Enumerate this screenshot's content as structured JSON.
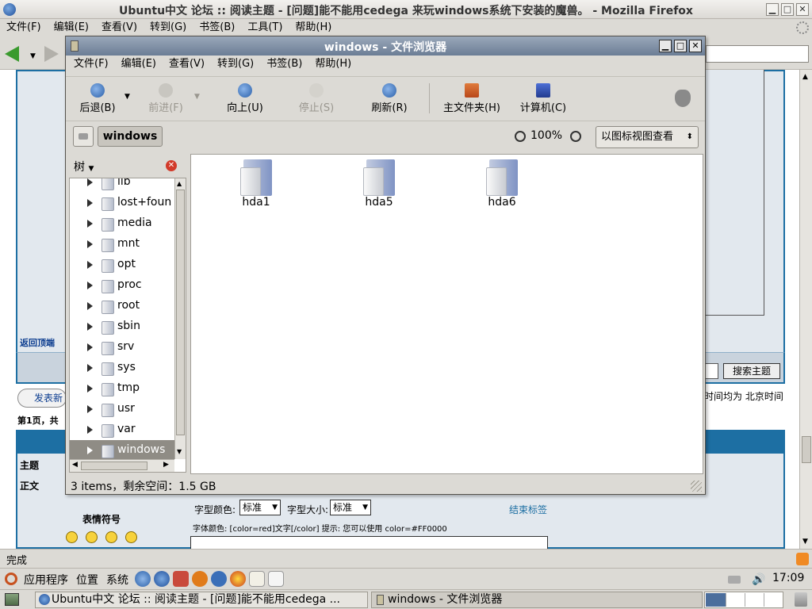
{
  "firefox": {
    "title": "Ubuntu中文 论坛 :: 阅读主题 - [问题]能不能用cedega 来玩windows系统下安装的魔兽。 - Mozilla Firefox",
    "menu": [
      "文件(F)",
      "编辑(E)",
      "查看(V)",
      "转到(G)",
      "书签(B)",
      "工具(T)",
      "帮助(H)"
    ],
    "status": "完成"
  },
  "forum": {
    "back_to_top": "返回顶端",
    "search_button": "搜索主题",
    "timezone_text": "时间均为 北京时间",
    "new_post": "发表新",
    "page_info": "第1页，共",
    "subject_label": "主题",
    "body_label": "正文",
    "font_color_label": "字型颜色:",
    "font_color_value": "标准",
    "font_size_label": "字型大小:",
    "font_size_value": "标准",
    "close_tags": "结束标签",
    "hint": "字体颜色: [color=red]文字[/color]  提示: 您可以使用 color=#FF0000",
    "emoticons_label": "表情符号"
  },
  "nautilus": {
    "title": "windows - 文件浏览器",
    "menu": [
      "文件(F)",
      "编辑(E)",
      "查看(V)",
      "转到(G)",
      "书签(B)",
      "帮助(H)"
    ],
    "toolbar": {
      "back": "后退(B)",
      "forward": "前进(F)",
      "up": "向上(U)",
      "stop": "停止(S)",
      "reload": "刷新(R)",
      "home": "主文件夹(H)",
      "computer": "计算机(C)"
    },
    "location": "windows",
    "zoom": "100%",
    "view_mode": "以图标视图查看",
    "sidebar_mode": "树",
    "tree": [
      "lib",
      "lost+foun",
      "media",
      "mnt",
      "opt",
      "proc",
      "root",
      "sbin",
      "srv",
      "sys",
      "tmp",
      "usr",
      "var",
      "windows"
    ],
    "items": [
      "hda1",
      "hda5",
      "hda6"
    ],
    "status": "3 items，剩余空间：1.5 GB"
  },
  "panel": {
    "applications": "应用程序",
    "places": "位置",
    "system": "系统",
    "clock": "17:09"
  },
  "taskbar": [
    "Ubuntu中文 论坛 :: 阅读主题 - [问题]能不能用cedega ...",
    "windows - 文件浏览器"
  ]
}
